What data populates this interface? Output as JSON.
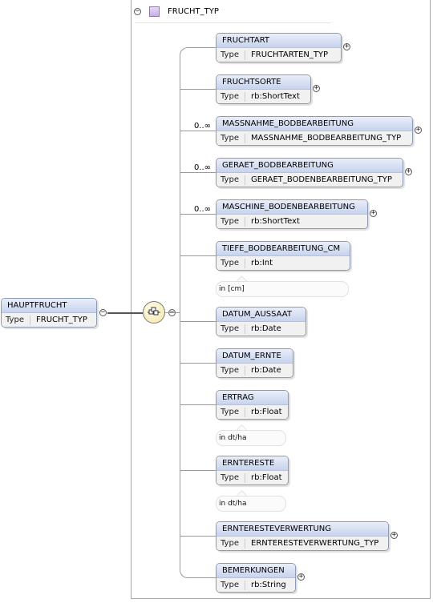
{
  "root": {
    "name": "HAUPTFRUCHT",
    "type_label": "Type",
    "type_value": "FRUCHT_TYP"
  },
  "complex_type": {
    "name": "FRUCHT_TYP"
  },
  "elements": [
    {
      "name": "FRUCHTART",
      "type_label": "Type",
      "type_value": "FRUCHTARTEN_TYP",
      "multiplicity": "",
      "note": "",
      "expandable": true
    },
    {
      "name": "FRUCHTSORTE",
      "type_label": "Type",
      "type_value": "rb:ShortText",
      "multiplicity": "",
      "note": "",
      "expandable": true
    },
    {
      "name": "MASSNAHME_BODBEARBEITUNG",
      "type_label": "Type",
      "type_value": "MASSNAHME_BODBEARBEITUNG_TYP",
      "multiplicity": "0..∞",
      "note": "",
      "expandable": true
    },
    {
      "name": "GERAET_BODBEARBEITUNG",
      "type_label": "Type",
      "type_value": "GERAET_BODENBEARBEITUNG_TYP",
      "multiplicity": "0..∞",
      "note": "",
      "expandable": true
    },
    {
      "name": "MASCHINE_BODENBEARBEITUNG",
      "type_label": "Type",
      "type_value": "rb:ShortText",
      "multiplicity": "0..∞",
      "note": "",
      "expandable": true
    },
    {
      "name": "TIEFE_BODBEARBEITUNG_CM",
      "type_label": "Type",
      "type_value": "rb:Int",
      "multiplicity": "",
      "note": "in [cm]",
      "expandable": false
    },
    {
      "name": "DATUM_AUSSAAT",
      "type_label": "Type",
      "type_value": "rb:Date",
      "multiplicity": "",
      "note": "",
      "expandable": false
    },
    {
      "name": "DATUM_ERNTE",
      "type_label": "Type",
      "type_value": "rb:Date",
      "multiplicity": "",
      "note": "",
      "expandable": false
    },
    {
      "name": "ERTRAG",
      "type_label": "Type",
      "type_value": "rb:Float",
      "multiplicity": "",
      "note": "in dt/ha",
      "expandable": false
    },
    {
      "name": "ERNTERESTE",
      "type_label": "Type",
      "type_value": "rb:Float",
      "multiplicity": "",
      "note": "in dt/ha",
      "expandable": false
    },
    {
      "name": "ERNTERESTEVERWERTUNG",
      "type_label": "Type",
      "type_value": "ERNTERESTEVERWERTUNG_TYP",
      "multiplicity": "",
      "note": "",
      "expandable": true
    },
    {
      "name": "BEMERKUNGEN",
      "type_label": "Type",
      "type_value": "rb:String",
      "multiplicity": "",
      "note": "",
      "expandable": true
    }
  ]
}
